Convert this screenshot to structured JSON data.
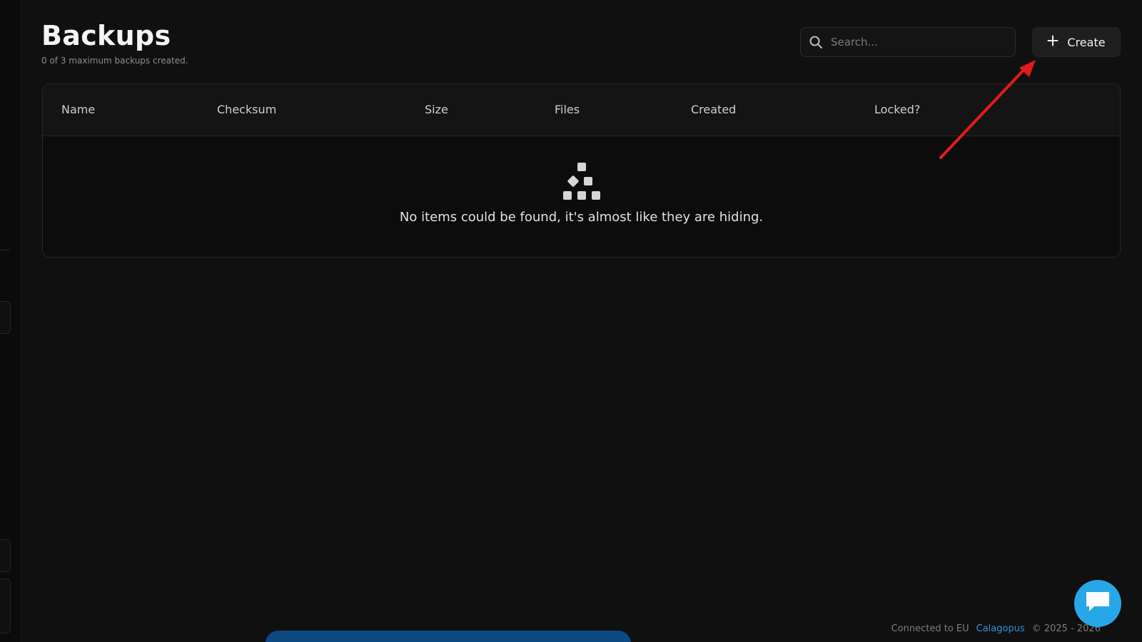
{
  "header": {
    "title": "Backups",
    "subtitle": "0 of 3 maximum backups created."
  },
  "search": {
    "placeholder": "Search..."
  },
  "toolbar": {
    "create_label": "Create"
  },
  "table": {
    "columns": [
      "Name",
      "Checksum",
      "Size",
      "Files",
      "Created",
      "Locked?"
    ],
    "empty_message": "No items could be found, it's almost like they are hiding."
  },
  "footer": {
    "connection": "Connected to EU",
    "brand": "Calagopus",
    "copyright": "© 2025 - 2026"
  },
  "colors": {
    "background": "#101010",
    "accent_link": "#2f8fe0",
    "chat_button": "#28a7e8",
    "annotation_arrow": "#e31b1b"
  },
  "icons": [
    "search-icon",
    "plus-icon",
    "empty-boxes-icon",
    "chat-icon"
  ]
}
